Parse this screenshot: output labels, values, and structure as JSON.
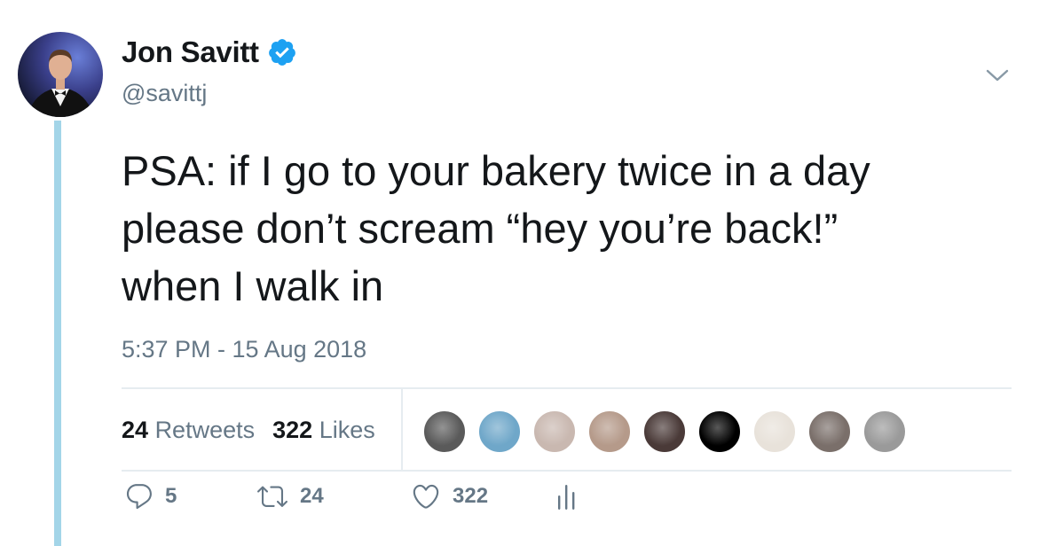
{
  "user": {
    "name": "Jon Savitt",
    "handle": "@savittj",
    "verified": true
  },
  "tweet": {
    "lines": [
      "PSA: if I go to your bakery twice in a day",
      "please don’t scream “hey you’re back!”",
      "when I walk in"
    ],
    "timestamp": "5:37 PM - 15 Aug 2018"
  },
  "stats": {
    "retweets_count": "24",
    "retweets_label": "Retweets",
    "likes_count": "322",
    "likes_label": "Likes"
  },
  "likers": [
    {
      "icon": "liker-avatar-1",
      "color": "#5a5a5a"
    },
    {
      "icon": "liker-avatar-2",
      "color": "#6fa7c9"
    },
    {
      "icon": "liker-avatar-3",
      "color": "#c9b8b0"
    },
    {
      "icon": "liker-avatar-4",
      "color": "#b59a8a"
    },
    {
      "icon": "liker-avatar-5",
      "color": "#4a3a38"
    },
    {
      "icon": "liker-avatar-6",
      "color": "#000000"
    },
    {
      "icon": "liker-avatar-7",
      "color": "#e8e2da"
    },
    {
      "icon": "liker-avatar-8",
      "color": "#7a6f6a"
    },
    {
      "icon": "liker-avatar-9",
      "color": "#9a9a9a"
    }
  ],
  "actions": {
    "reply_count": "5",
    "retweet_count": "24",
    "like_count": "322"
  },
  "colors": {
    "verified_blue": "#1da1f2",
    "thread_line": "#a3d5e8",
    "secondary_text": "#657786"
  }
}
